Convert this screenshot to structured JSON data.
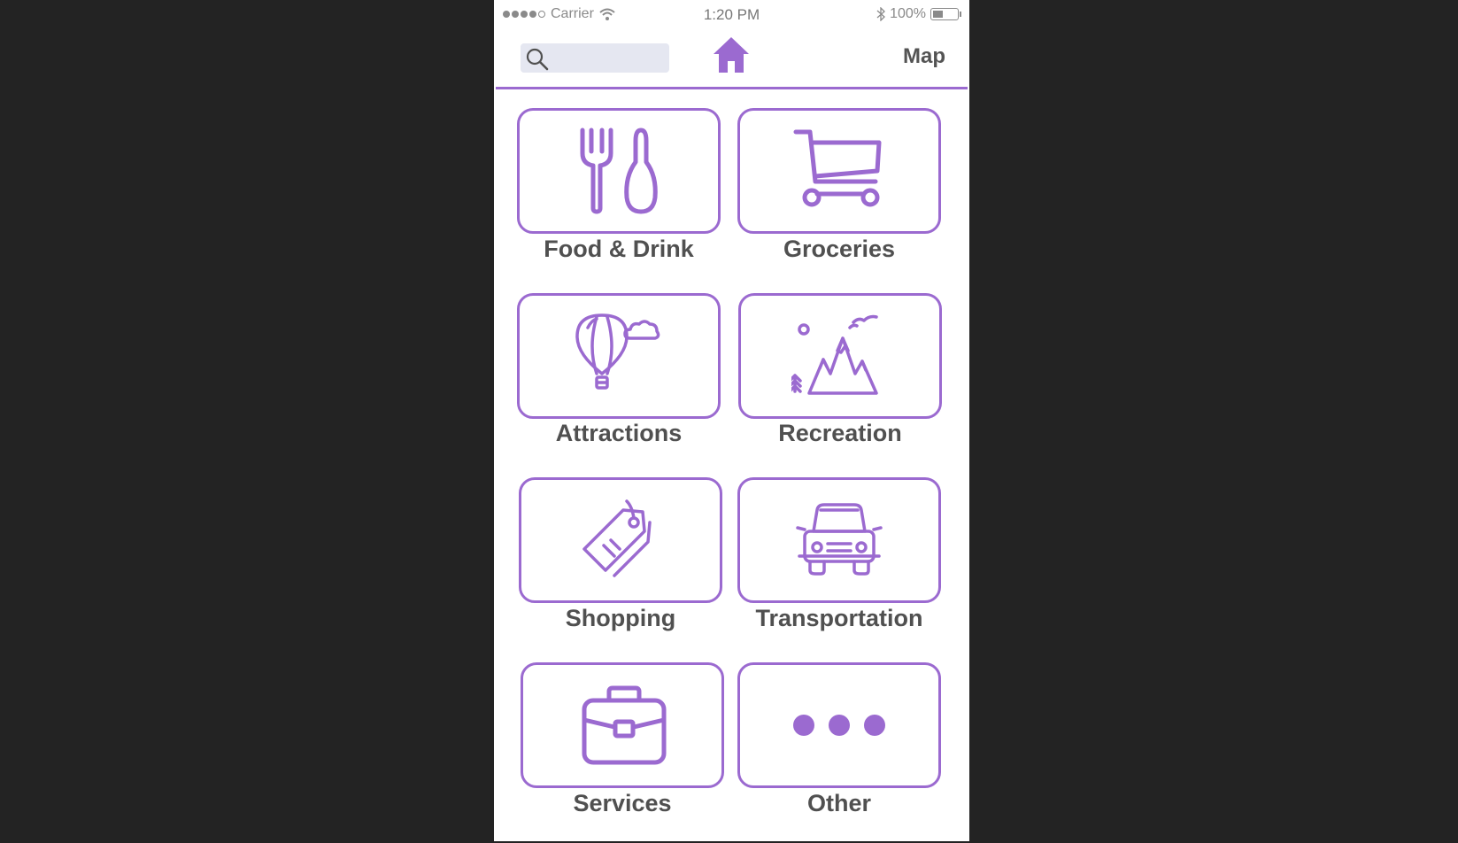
{
  "status_bar": {
    "carrier": "Carrier",
    "time": "1:20 PM",
    "battery_percent": "100%",
    "signal_bars": 4,
    "battery_level": 0.35
  },
  "nav": {
    "search_placeholder": "",
    "map_label": "Map"
  },
  "colors": {
    "accent": "#9b6ad0",
    "text": "#505050",
    "search_bg": "#e5e7f1"
  },
  "categories": [
    {
      "label": "Food & Drink",
      "icon": "fork-spoon-icon"
    },
    {
      "label": "Groceries",
      "icon": "shopping-cart-icon"
    },
    {
      "label": "Attractions",
      "icon": "hot-air-balloon-icon"
    },
    {
      "label": "Recreation",
      "icon": "mountains-icon"
    },
    {
      "label": "Shopping",
      "icon": "price-tag-icon"
    },
    {
      "label": "Transportation",
      "icon": "car-icon"
    },
    {
      "label": "Services",
      "icon": "briefcase-icon"
    },
    {
      "label": "Other",
      "icon": "more-dots-icon"
    }
  ]
}
